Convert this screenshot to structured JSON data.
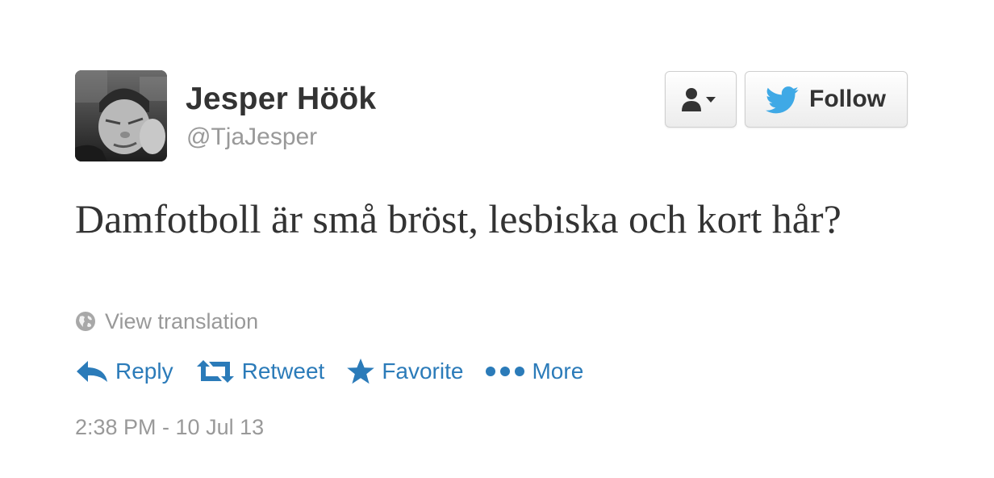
{
  "user": {
    "display_name": "Jesper Höök",
    "screen_name": "@TjaJesper"
  },
  "header": {
    "user_actions_icon": "user-dropdown-icon",
    "follow_icon": "twitter-bird-icon",
    "follow_label": "Follow"
  },
  "tweet": {
    "text": "Damfotboll är små bröst, lesbiska och kort hår?",
    "translation_icon": "globe-icon",
    "translation_label": "View translation",
    "timestamp": "2:38 PM - 10 Jul 13"
  },
  "actions": [
    {
      "icon": "reply-icon",
      "label": "Reply"
    },
    {
      "icon": "retweet-icon",
      "label": "Retweet"
    },
    {
      "icon": "star-icon",
      "label": "Favorite"
    },
    {
      "icon": "more-dots-icon",
      "label": "More"
    }
  ],
  "colors": {
    "link": "#2b7bb9",
    "muted": "#999999",
    "text": "#333333",
    "twitter_blue": "#3fa9e6"
  }
}
